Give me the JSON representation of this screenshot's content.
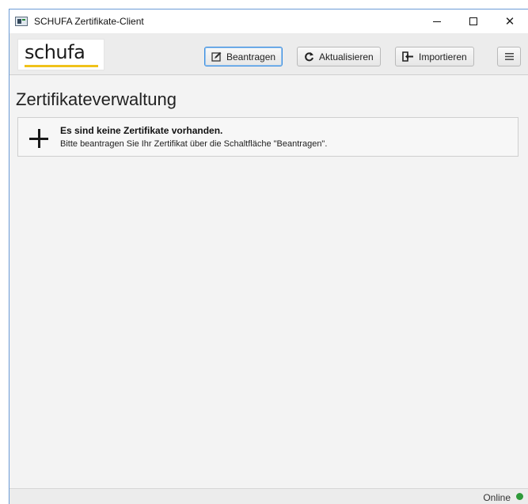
{
  "window": {
    "title": "SCHUFA Zertifikate-Client",
    "controls": {
      "minimize": "minimize-icon",
      "maximize": "maximize-icon",
      "close": "✕"
    }
  },
  "toolbar": {
    "logo_text": "schufa",
    "buttons": [
      {
        "label": "Beantragen",
        "icon": "edit-icon",
        "active": true
      },
      {
        "label": "Aktualisieren",
        "icon": "refresh-icon",
        "active": false
      },
      {
        "label": "Importieren",
        "icon": "import-icon",
        "active": false
      }
    ],
    "menu_icon": "hamburger-icon"
  },
  "main": {
    "title": "Zertifikateverwaltung",
    "empty_state": {
      "icon": "plus-icon",
      "heading": "Es sind keine Zertifikate vorhanden.",
      "text": "Bitte beantragen Sie Ihr Zertifikat über die Schaltfläche \"Beantragen\"."
    }
  },
  "status": {
    "label": "Online",
    "color": "#2e9a3a"
  },
  "colors": {
    "accent": "#3b8ee0",
    "logo_underline": "#f0c21a"
  }
}
